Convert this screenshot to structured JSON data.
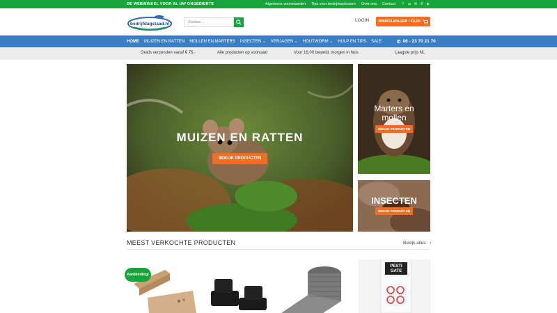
{
  "topbar": {
    "tagline": "DE WEBWINKEL VOOR AL UW ONGEDIERTE",
    "links": [
      "Algemene voorwaarden",
      "Tips voor bedrijfsoplossen",
      "Over ons",
      "Contact"
    ]
  },
  "header": {
    "logo_text": "bedrijfdagstaad.nl",
    "search_placeholder": "Zoeken...",
    "login_label": "LOGIN",
    "cart_label": "WINKELWAGEN / €0,00"
  },
  "nav": {
    "items": [
      "HOME",
      "MUIZEN EN RATTEN",
      "MOLLEN EN MARTERS",
      "INSECTEN",
      "VERJAGEN",
      "HOUTWORM",
      "HULP EN TIPS",
      "SALE"
    ],
    "phone": "06 - 23 70 21 70"
  },
  "usp": [
    "Gratis verzenden vanaf € 75,-",
    "Alle producten op voorraad",
    "Voor 16.00 besteld, morgen in huis",
    "Laagste prijs NL"
  ],
  "hero": {
    "title": "MUIZEN EN RATTEN",
    "button": "BEKIJK PRODUCTEN"
  },
  "side1": {
    "title_line1": "Marters en",
    "title_line2": "mollen",
    "button": "BEKIJK PRODUCTEN"
  },
  "side2": {
    "title": "INSECTEN",
    "button": "BEKIJK PRODUCTEN"
  },
  "bestsellers": {
    "title": "MEEST VERKOCHTE PRODUCTEN",
    "see_all": "Bekijk alles",
    "badge": "Aanbieding!",
    "product4_brand": "PESTI GATE"
  },
  "colors": {
    "green": "#17a43a",
    "blue": "#3a7fc5",
    "orange": "#f26c22"
  }
}
